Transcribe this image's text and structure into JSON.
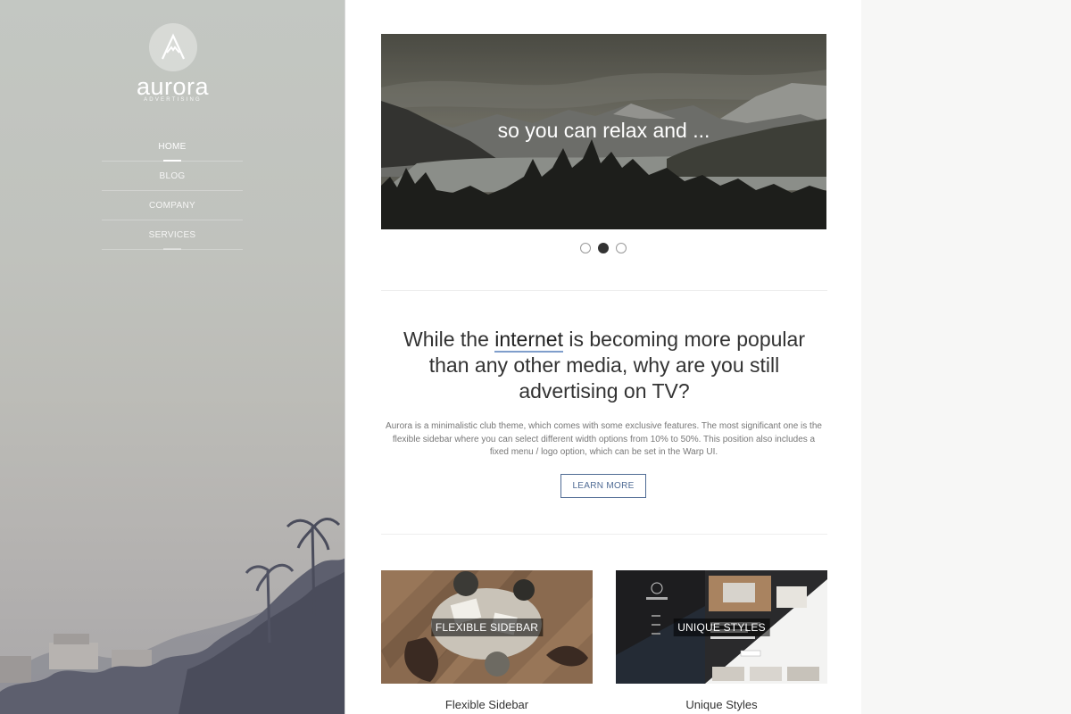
{
  "brand": {
    "name": "aurora",
    "tagline": "ADVERTISING"
  },
  "nav": {
    "items": [
      {
        "label": "HOME",
        "active": true
      },
      {
        "label": "BLOG",
        "active": false
      },
      {
        "label": "COMPANY",
        "active": false
      },
      {
        "label": "SERVICES",
        "active": false
      }
    ]
  },
  "slider": {
    "caption": "so you can relax and ...",
    "slide_count": 3,
    "active_slide": 2
  },
  "intro": {
    "headline_before": "While the ",
    "headline_highlight": "internet",
    "headline_after": " is becoming more popular than any other media, why are you still advertising on TV?",
    "body": "Aurora is a minimalistic club theme, which comes with some exclusive features. The most significant one is the flexible sidebar where you can select different width options from 10% to 50%. This position also includes a fixed menu / logo option, which can be set in the Warp UI.",
    "button_label": "LEARN MORE"
  },
  "features": [
    {
      "overlay": "FLEXIBLE SIDEBAR",
      "title": "Flexible Sidebar"
    },
    {
      "overlay": "UNIQUE STYLES",
      "title": "Unique Styles"
    }
  ],
  "colors": {
    "accent": "#4f6b94",
    "highlight_underline": "#7f9ecb",
    "sidebar_bg": "#c0c2bd",
    "page_bg": "#f7f7f6"
  },
  "icons": {
    "logo": "mountain-peak-logo-icon"
  }
}
